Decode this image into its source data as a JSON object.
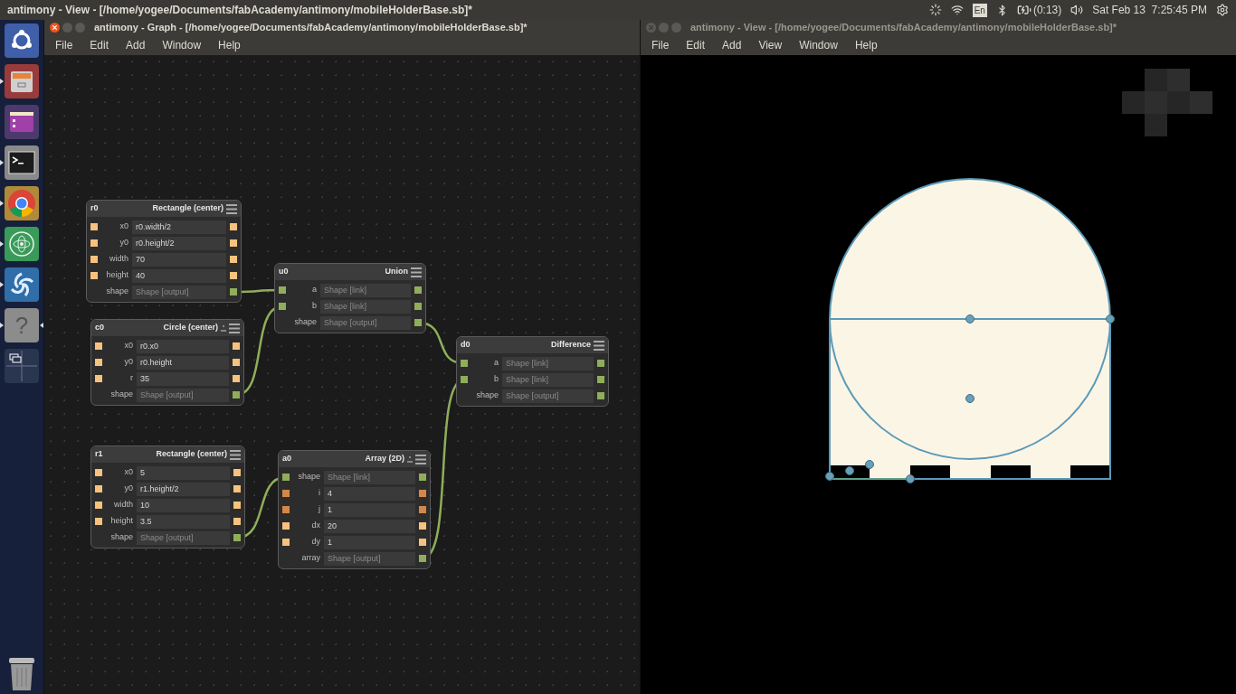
{
  "top_bar": {
    "title": "antimony - View - [/home/yogee/Documents/fabAcademy/antimony/mobileHolderBase.sb]*",
    "keyboard": "En",
    "battery": "(0:13)",
    "clock": "Sat Feb 13  7:25:45 PM"
  },
  "launcher": {
    "items": [
      {
        "kind": "ubuntu",
        "running": false,
        "focused": false
      },
      {
        "kind": "files",
        "running": true,
        "focused": false
      },
      {
        "kind": "window",
        "running": false,
        "focused": false
      },
      {
        "kind": "terminal",
        "running": true,
        "focused": false
      },
      {
        "kind": "browser",
        "running": true,
        "focused": false
      },
      {
        "kind": "atom",
        "running": true,
        "focused": false
      },
      {
        "kind": "swirl",
        "running": true,
        "focused": false
      },
      {
        "kind": "help",
        "glyph": "?",
        "running": true,
        "focused": true
      },
      {
        "kind": "workspaces",
        "running": false,
        "focused": false
      }
    ]
  },
  "graph_window": {
    "title": "antimony - Graph - [/home/yogee/Documents/fabAcademy/antimony/mobileHolderBase.sb]*",
    "active": true,
    "menu": [
      "File",
      "Edit",
      "Add",
      "Window",
      "Help"
    ],
    "nodes": [
      {
        "name": "r0",
        "type": "Rectangle (center)",
        "toggle": false,
        "fields": [
          {
            "label": "x0",
            "text": "r0.width/2",
            "kind": "value",
            "color": "#f7c27e",
            "input": true
          },
          {
            "label": "y0",
            "text": "r0.height/2",
            "kind": "value",
            "color": "#f7c27e",
            "input": true
          },
          {
            "label": "width",
            "text": "70",
            "kind": "value",
            "color": "#f7c27e",
            "input": true
          },
          {
            "label": "height",
            "text": "40",
            "kind": "value",
            "color": "#f7c27e",
            "input": true
          },
          {
            "label": "shape",
            "text": "Shape [output]",
            "kind": "shape",
            "color": "#8fae5a",
            "input": false
          }
        ]
      },
      {
        "name": "c0",
        "type": "Circle (center)",
        "toggle": true,
        "fields": [
          {
            "label": "x0",
            "text": "r0.x0",
            "kind": "value",
            "color": "#f7c27e",
            "input": true
          },
          {
            "label": "y0",
            "text": "r0.height",
            "kind": "value",
            "color": "#f7c27e",
            "input": true
          },
          {
            "label": "r",
            "text": "35",
            "kind": "value",
            "color": "#f7c27e",
            "input": true
          },
          {
            "label": "shape",
            "text": "Shape [output]",
            "kind": "shape",
            "color": "#8fae5a",
            "input": false
          }
        ]
      },
      {
        "name": "u0",
        "type": "Union",
        "toggle": false,
        "fields": [
          {
            "label": "a",
            "text": "Shape [link]",
            "kind": "shape",
            "color": "#8fae5a",
            "input": true
          },
          {
            "label": "b",
            "text": "Shape [link]",
            "kind": "shape",
            "color": "#8fae5a",
            "input": true
          },
          {
            "label": "shape",
            "text": "Shape [output]",
            "kind": "shape",
            "color": "#8fae5a",
            "input": false
          }
        ]
      },
      {
        "name": "d0",
        "type": "Difference",
        "toggle": false,
        "fields": [
          {
            "label": "a",
            "text": "Shape [link]",
            "kind": "shape",
            "color": "#8fae5a",
            "input": true
          },
          {
            "label": "b",
            "text": "Shape [link]",
            "kind": "shape",
            "color": "#8fae5a",
            "input": true
          },
          {
            "label": "shape",
            "text": "Shape [output]",
            "kind": "shape",
            "color": "#8fae5a",
            "input": false
          }
        ]
      },
      {
        "name": "r1",
        "type": "Rectangle (center)",
        "toggle": false,
        "fields": [
          {
            "label": "x0",
            "text": "5",
            "kind": "value",
            "color": "#f7c27e",
            "input": true
          },
          {
            "label": "y0",
            "text": "r1.height/2",
            "kind": "value",
            "color": "#f7c27e",
            "input": true
          },
          {
            "label": "width",
            "text": "10",
            "kind": "value",
            "color": "#f7c27e",
            "input": true
          },
          {
            "label": "height",
            "text": "3.5",
            "kind": "value",
            "color": "#f7c27e",
            "input": true
          },
          {
            "label": "shape",
            "text": "Shape [output]",
            "kind": "shape",
            "color": "#8fae5a",
            "input": false
          }
        ]
      },
      {
        "name": "a0",
        "type": "Array (2D)",
        "toggle": true,
        "fields": [
          {
            "label": "shape",
            "text": "Shape [link]",
            "kind": "shape",
            "color": "#8fae5a",
            "input": true
          },
          {
            "label": "i",
            "text": "4",
            "kind": "value",
            "color": "#d4874a",
            "input": true
          },
          {
            "label": "j",
            "text": "1",
            "kind": "value",
            "color": "#d4874a",
            "input": true
          },
          {
            "label": "dx",
            "text": "20",
            "kind": "value",
            "color": "#f7c27e",
            "input": true
          },
          {
            "label": "dy",
            "text": "1",
            "kind": "value",
            "color": "#f7c27e",
            "input": true
          },
          {
            "label": "array",
            "text": "Shape [output]",
            "kind": "shape",
            "color": "#8fae5a",
            "input": false
          }
        ]
      }
    ]
  },
  "view_window": {
    "title": "antimony - View - [/home/yogee/Documents/fabAcademy/antimony/mobileHolderBase.sb]*",
    "active": false,
    "menu": [
      "File",
      "Edit",
      "Add",
      "View",
      "Window",
      "Help"
    ]
  }
}
